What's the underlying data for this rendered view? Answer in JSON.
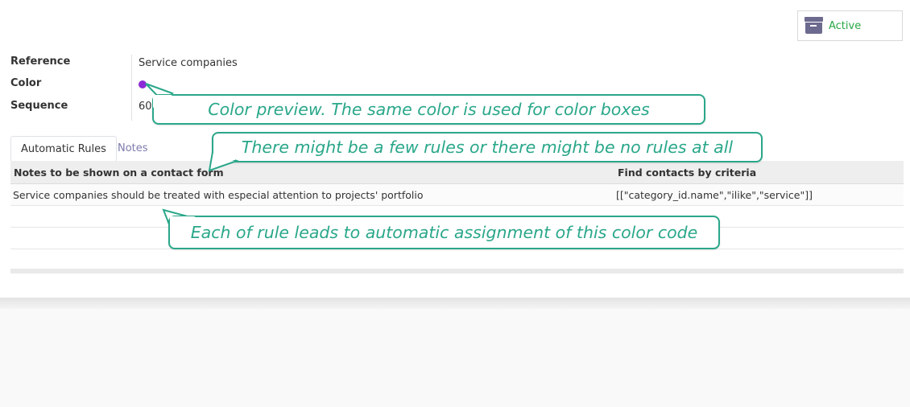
{
  "header": {
    "active_button_label": "Active",
    "active_icon": "archive-icon"
  },
  "fields": {
    "reference_label": "Reference",
    "reference_value": "Service companies",
    "color_label": "Color",
    "color_value": "#8c2bd6",
    "sequence_label": "Sequence",
    "sequence_value": "60"
  },
  "tabs": [
    {
      "label": "Automatic Rules",
      "active": true
    },
    {
      "label": "Notes",
      "active": false
    }
  ],
  "table": {
    "columns": [
      "Notes to be shown on a contact form",
      "Find contacts by criteria"
    ],
    "rows": [
      [
        "Service companies should be treated with especial attention to projects' portfolio",
        "[[\"category_id.name\",\"ilike\",\"service\"]]"
      ]
    ]
  },
  "callouts": {
    "color_preview": "Color preview. The same color is used for color boxes",
    "rules_count": "There might be a few rules or there might be no rules at all",
    "rule_assignment": "Each of rule leads to automatic assignment of this color code"
  },
  "colors": {
    "accent_green": "#28a745",
    "callout_teal": "#2aa78a",
    "tab_link": "#7c7bad",
    "icon_purple": "#6d6a8f"
  }
}
